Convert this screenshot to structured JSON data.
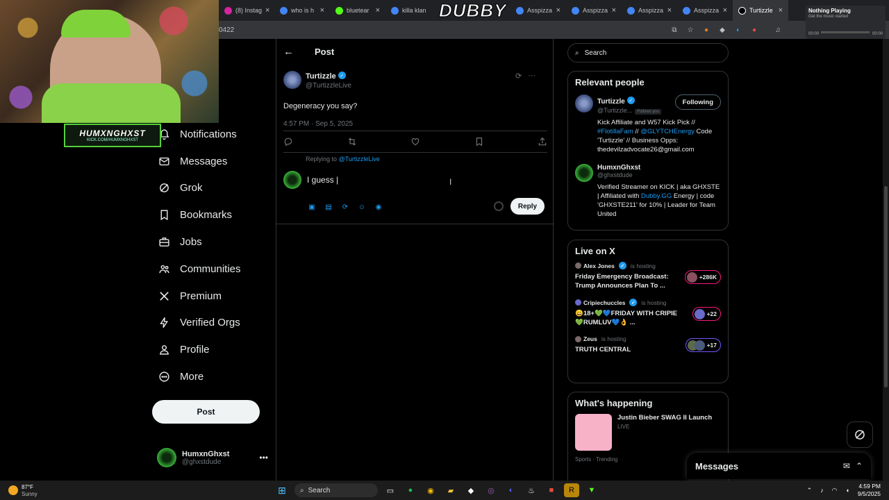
{
  "browser": {
    "tabs": [
      {
        "label": "(8) Instag",
        "color": "#d6249f"
      },
      {
        "label": "who is h",
        "color": "#4285f4"
      },
      {
        "label": "bluetear",
        "color": "#53fc18"
      },
      {
        "label": "killa klan",
        "color": "#4285f4"
      },
      {
        "label": "Asspizza",
        "color": "#4285f4"
      },
      {
        "label": "Asspizza",
        "color": "#4285f4"
      },
      {
        "label": "Asspizza",
        "color": "#4285f4"
      },
      {
        "label": "Asspizza",
        "color": "#4285f4"
      },
      {
        "label": "Turtizzle",
        "color": "#ffffff"
      }
    ],
    "brand_overlay": "DUBBY",
    "url_fragment": "0422"
  },
  "media_widget": {
    "title": "Nothing Playing",
    "subtitle": "Get the music started",
    "time_start": "00:00",
    "time_end": "00:00"
  },
  "stream_tag": {
    "name": "HUMXNGHXST",
    "url": "KICK.COM/HUMXNGHXST"
  },
  "nav": {
    "items": [
      {
        "label": "Notifications",
        "icon": "bell-icon"
      },
      {
        "label": "Messages",
        "icon": "envelope-icon"
      },
      {
        "label": "Grok",
        "icon": "grok-icon"
      },
      {
        "label": "Bookmarks",
        "icon": "bookmark-icon"
      },
      {
        "label": "Jobs",
        "icon": "briefcase-icon"
      },
      {
        "label": "Communities",
        "icon": "people-icon"
      },
      {
        "label": "Premium",
        "icon": "x-logo-icon"
      },
      {
        "label": "Verified Orgs",
        "icon": "lightning-icon"
      },
      {
        "label": "Profile",
        "icon": "person-icon"
      },
      {
        "label": "More",
        "icon": "more-circle-icon"
      }
    ],
    "post_button": "Post",
    "account": {
      "name": "HumxnGhxst",
      "handle": "@ghxstdude"
    }
  },
  "post": {
    "header": "Post",
    "author_name": "Turtizzle",
    "author_handle": "@TurtizzleLive",
    "text": "Degeneracy you say?",
    "timestamp": "4:57 PM · Sep 5, 2025",
    "replying_prefix": "Replying to",
    "replying_handle": "@TurtizzleLive",
    "draft_text": "I guess |",
    "reply_button": "Reply"
  },
  "sidebar": {
    "search_placeholder": "Search",
    "relevant_title": "Relevant people",
    "people": [
      {
        "name": "Turtizzle",
        "handle": "@Turtizzle...",
        "follows_you": "Follows you",
        "button": "Following",
        "bio_a": "Kick Affiliate and W57 Kick Pick //",
        "bio_link1": "#FlotillaFam",
        "bio_mid": " // ",
        "bio_link2": "@GLYTCHEnergy",
        "bio_b": " Code 'Turtizzle' // Business Opps: thedevilzadvocate26@gmail.com"
      },
      {
        "name": "HumxnGhxst",
        "handle": "@ghxstdude",
        "bio_a": "Verified Streamer on KICK | aka GHXSTE | Affiliated with ",
        "bio_link1": "Dubby.GG",
        "bio_b": " Energy | code 'GHXSTE211' for 10% | Leader for Team United"
      }
    ],
    "live_title": "Live on X",
    "live": [
      {
        "host": "Alex Jones",
        "hosting": "is hosting",
        "title": "Friday Emergency Broadcast: Trump Announces Plan To ...",
        "count": "+286K"
      },
      {
        "host": "Cripiechuccles",
        "hosting": "is hosting",
        "title": "😄18+💚💙FRIDAY WITH CRIPIE💚RUMLUV💙👌 ...",
        "count": "+22"
      },
      {
        "host": "Zeus",
        "hosting": "is hosting",
        "title": "TRUTH CENTRAL",
        "count": "+17"
      }
    ],
    "happening_title": "What's happening",
    "happening": {
      "title": "Justin Bieber SWAG II Launch",
      "sub": "LIVE"
    },
    "trend_label": "Sports · Trending"
  },
  "messages_drawer": {
    "label": "Messages"
  },
  "taskbar": {
    "weather_temp": "87°F",
    "weather_desc": "Sunny",
    "search_label": "Search",
    "time": "4:59 PM",
    "date": "9/5/2025"
  }
}
